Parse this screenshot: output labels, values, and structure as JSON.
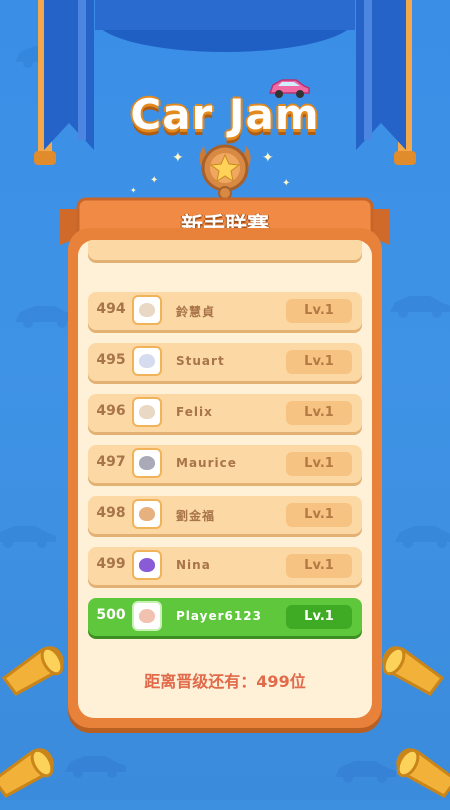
{
  "game": {
    "logo": "Car Jam"
  },
  "league": {
    "title": "新手联赛"
  },
  "leaderboard": [
    {
      "rank": "494",
      "name": "鈴慧貞",
      "level": "Lv.1",
      "avatar": "cat-avatar",
      "me": false
    },
    {
      "rank": "495",
      "name": "Stuart",
      "level": "Lv.1",
      "avatar": "white-car-avatar",
      "me": false
    },
    {
      "rank": "496",
      "name": "Felix",
      "level": "Lv.1",
      "avatar": "cat-avatar",
      "me": false
    },
    {
      "rank": "497",
      "name": "Maurice",
      "level": "Lv.1",
      "avatar": "koala-avatar",
      "me": false
    },
    {
      "rank": "498",
      "name": "劉金福",
      "level": "Lv.1",
      "avatar": "fox-avatar",
      "me": false
    },
    {
      "rank": "499",
      "name": "Nina",
      "level": "Lv.1",
      "avatar": "purple-car-avatar",
      "me": false
    },
    {
      "rank": "500",
      "name": "Player6123",
      "level": "Lv.1",
      "avatar": "rabbit-avatar",
      "me": true
    }
  ],
  "promotion": {
    "text": "距离晋级还有：499位"
  },
  "colors": {
    "background": "#3d8fe0",
    "panel": "#e8823a",
    "row": "#fcd9a4",
    "highlight": "#5fc73c"
  }
}
